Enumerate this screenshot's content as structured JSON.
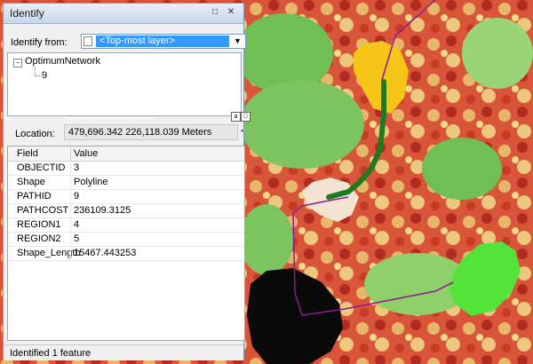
{
  "window": {
    "title": "Identify",
    "pin_icon": "□",
    "close_icon": "✕"
  },
  "identify_from": {
    "label": "Identify from:",
    "value": "<Top-most layer>"
  },
  "tree": {
    "root": "OptimumNetwork",
    "child": "9"
  },
  "location": {
    "label": "Location:",
    "value": "479,696.342  226,118.039 Meters"
  },
  "grid": {
    "columns": [
      "Field",
      "Value"
    ],
    "rows": [
      {
        "field": "OBJECTID",
        "value": "3"
      },
      {
        "field": "Shape",
        "value": "Polyline"
      },
      {
        "field": "PATHID",
        "value": "9"
      },
      {
        "field": "PATHCOST",
        "value": "236109.3125"
      },
      {
        "field": "REGION1",
        "value": "4"
      },
      {
        "field": "REGION2",
        "value": "5"
      },
      {
        "field": "Shape_Length",
        "value": "15467.443253"
      }
    ]
  },
  "status": {
    "text": "Identified 1 feature"
  },
  "map_colors": {
    "cost_low": "#4caf50",
    "cost_mid": "#f2d67a",
    "cost_high": "#c0392b",
    "region_yellow": "#f5c518",
    "region_beige": "#f3e3d3",
    "region_black": "#0a0a0a",
    "region_green": "#55e33a",
    "network_line": "#8e1b8e",
    "selected_path": "#1e7a1e"
  }
}
